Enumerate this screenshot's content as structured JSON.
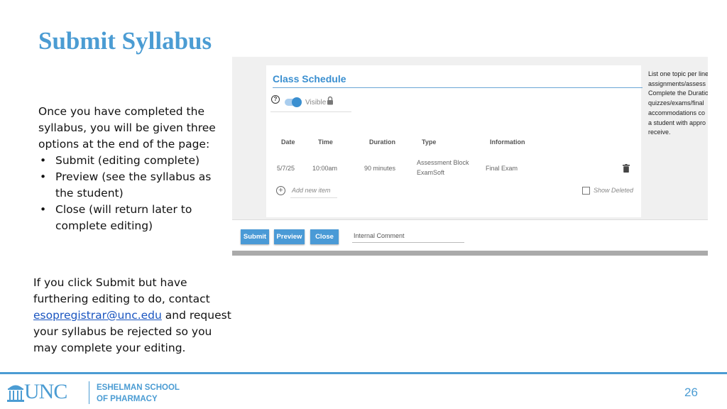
{
  "slide": {
    "title": "Submit Syllabus",
    "intro": {
      "text": "Once you have completed the syllabus, you will be given three options at the end of the page:",
      "bullets": [
        "Submit (editing complete)",
        "Preview (see the syllabus as the student)",
        "Close (will return later to complete editing)"
      ]
    },
    "note": {
      "before": "If you click Submit but have furthering editing to do, contact ",
      "email": "esopregistrar@unc.edu",
      "after": " and request your syllabus be rejected so you may complete your editing."
    },
    "page_number": "26"
  },
  "screenshot": {
    "section_title": "Class Schedule",
    "help_icon": "question-circle-icon",
    "visible_label": "Visible",
    "table": {
      "headers": [
        "Date",
        "Time",
        "Duration",
        "Type",
        "Information"
      ],
      "rows": [
        {
          "date": "5/7/25",
          "time": "10:00am",
          "duration": "90 minutes",
          "type_line1": "Assessment Block",
          "type_line2": "ExamSoft",
          "information": "Final Exam"
        }
      ]
    },
    "add_item_label": "Add new item",
    "show_deleted_label": "Show Deleted",
    "side_text": [
      "List one topic per line",
      "assignments/assess",
      "Complete the Duratio",
      "quizzes/exams/final",
      "accommodations co",
      "a student with appro",
      "receive."
    ],
    "buttons": {
      "submit": "Submit",
      "preview": "Preview",
      "close": "Close"
    },
    "internal_comment_label": "Internal Comment"
  },
  "footer": {
    "logo_text": "UNC",
    "school_line1": "ESHELMAN SCHOOL",
    "school_line2": "OF PHARMACY"
  },
  "colors": {
    "brand_blue": "#4b9cd3",
    "button_blue": "#4a9ad6",
    "link_blue": "#1a55c0"
  }
}
